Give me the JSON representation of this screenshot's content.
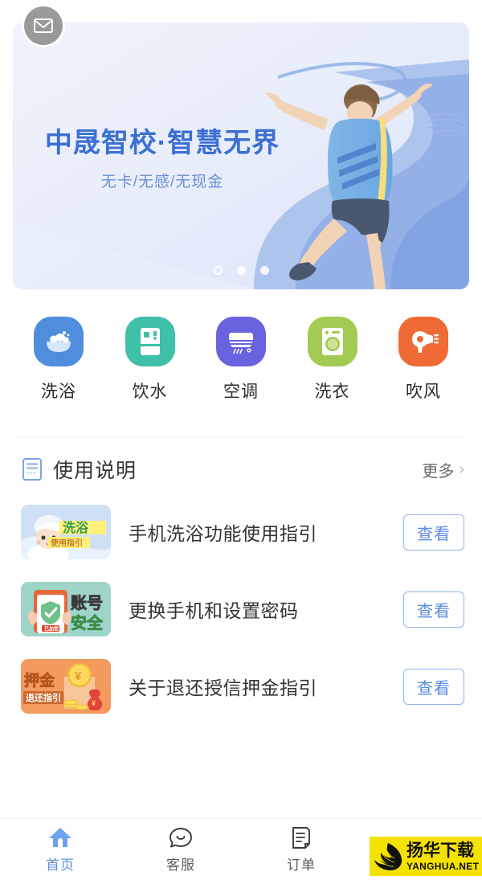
{
  "colors": {
    "accent": "#5b8ce0",
    "banner_title": "#3b6fd4",
    "banner_sub": "#6d8fd2",
    "bath": "#4f8ddd",
    "water": "#3fc0a8",
    "aircon": "#6a63e0",
    "laundry": "#a3ca52",
    "dryer": "#ef6a35",
    "watermark_bg": "#f5e200"
  },
  "banner": {
    "title": "中晟智校·智慧无界",
    "subtitle": "无卡/无感/无现金",
    "message_icon": "envelope-icon",
    "dots": [
      {
        "active": true
      },
      {
        "active": false
      },
      {
        "active": false
      }
    ]
  },
  "categories": [
    {
      "label": "洗浴",
      "icon": "bathtub-icon",
      "color": "#4f8ddd"
    },
    {
      "label": "饮水",
      "icon": "water-dispenser-icon",
      "color": "#3fc0a8"
    },
    {
      "label": "空调",
      "icon": "air-conditioner-icon",
      "color": "#6a63e0"
    },
    {
      "label": "洗衣",
      "icon": "washing-machine-icon",
      "color": "#a3ca52"
    },
    {
      "label": "吹风",
      "icon": "hair-dryer-icon",
      "color": "#ef6a35"
    }
  ],
  "instructions": {
    "icon": "document-list-icon",
    "title": "使用说明",
    "more_label": "更多",
    "chevron": "›",
    "items": [
      {
        "title": "手机洗浴功能使用指引",
        "button_label": "查看",
        "thumb_name": "bath-guide-thumbnail",
        "thumb_main_text": "洗浴",
        "thumb_sub_text": "使用指引"
      },
      {
        "title": "更换手机和设置密码",
        "button_label": "查看",
        "thumb_name": "account-security-thumbnail",
        "thumb_main_text": "账号",
        "thumb_sub_text": "安全",
        "thumb_tag_text": "已加密"
      },
      {
        "title": "关于退还授信押金指引",
        "button_label": "查看",
        "thumb_name": "deposit-refund-thumbnail",
        "thumb_main_text": "押金",
        "thumb_sub_text": "退还指引"
      }
    ]
  },
  "tabbar": [
    {
      "label": "首页",
      "icon": "home-icon",
      "active": true
    },
    {
      "label": "客服",
      "icon": "customer-service-icon",
      "active": false
    },
    {
      "label": "订单",
      "icon": "order-list-icon",
      "active": false
    },
    {
      "label": "",
      "icon": "profile-icon",
      "active": false
    }
  ],
  "watermark": {
    "cn": "扬华下载",
    "en": "YANGHUA.NET"
  }
}
